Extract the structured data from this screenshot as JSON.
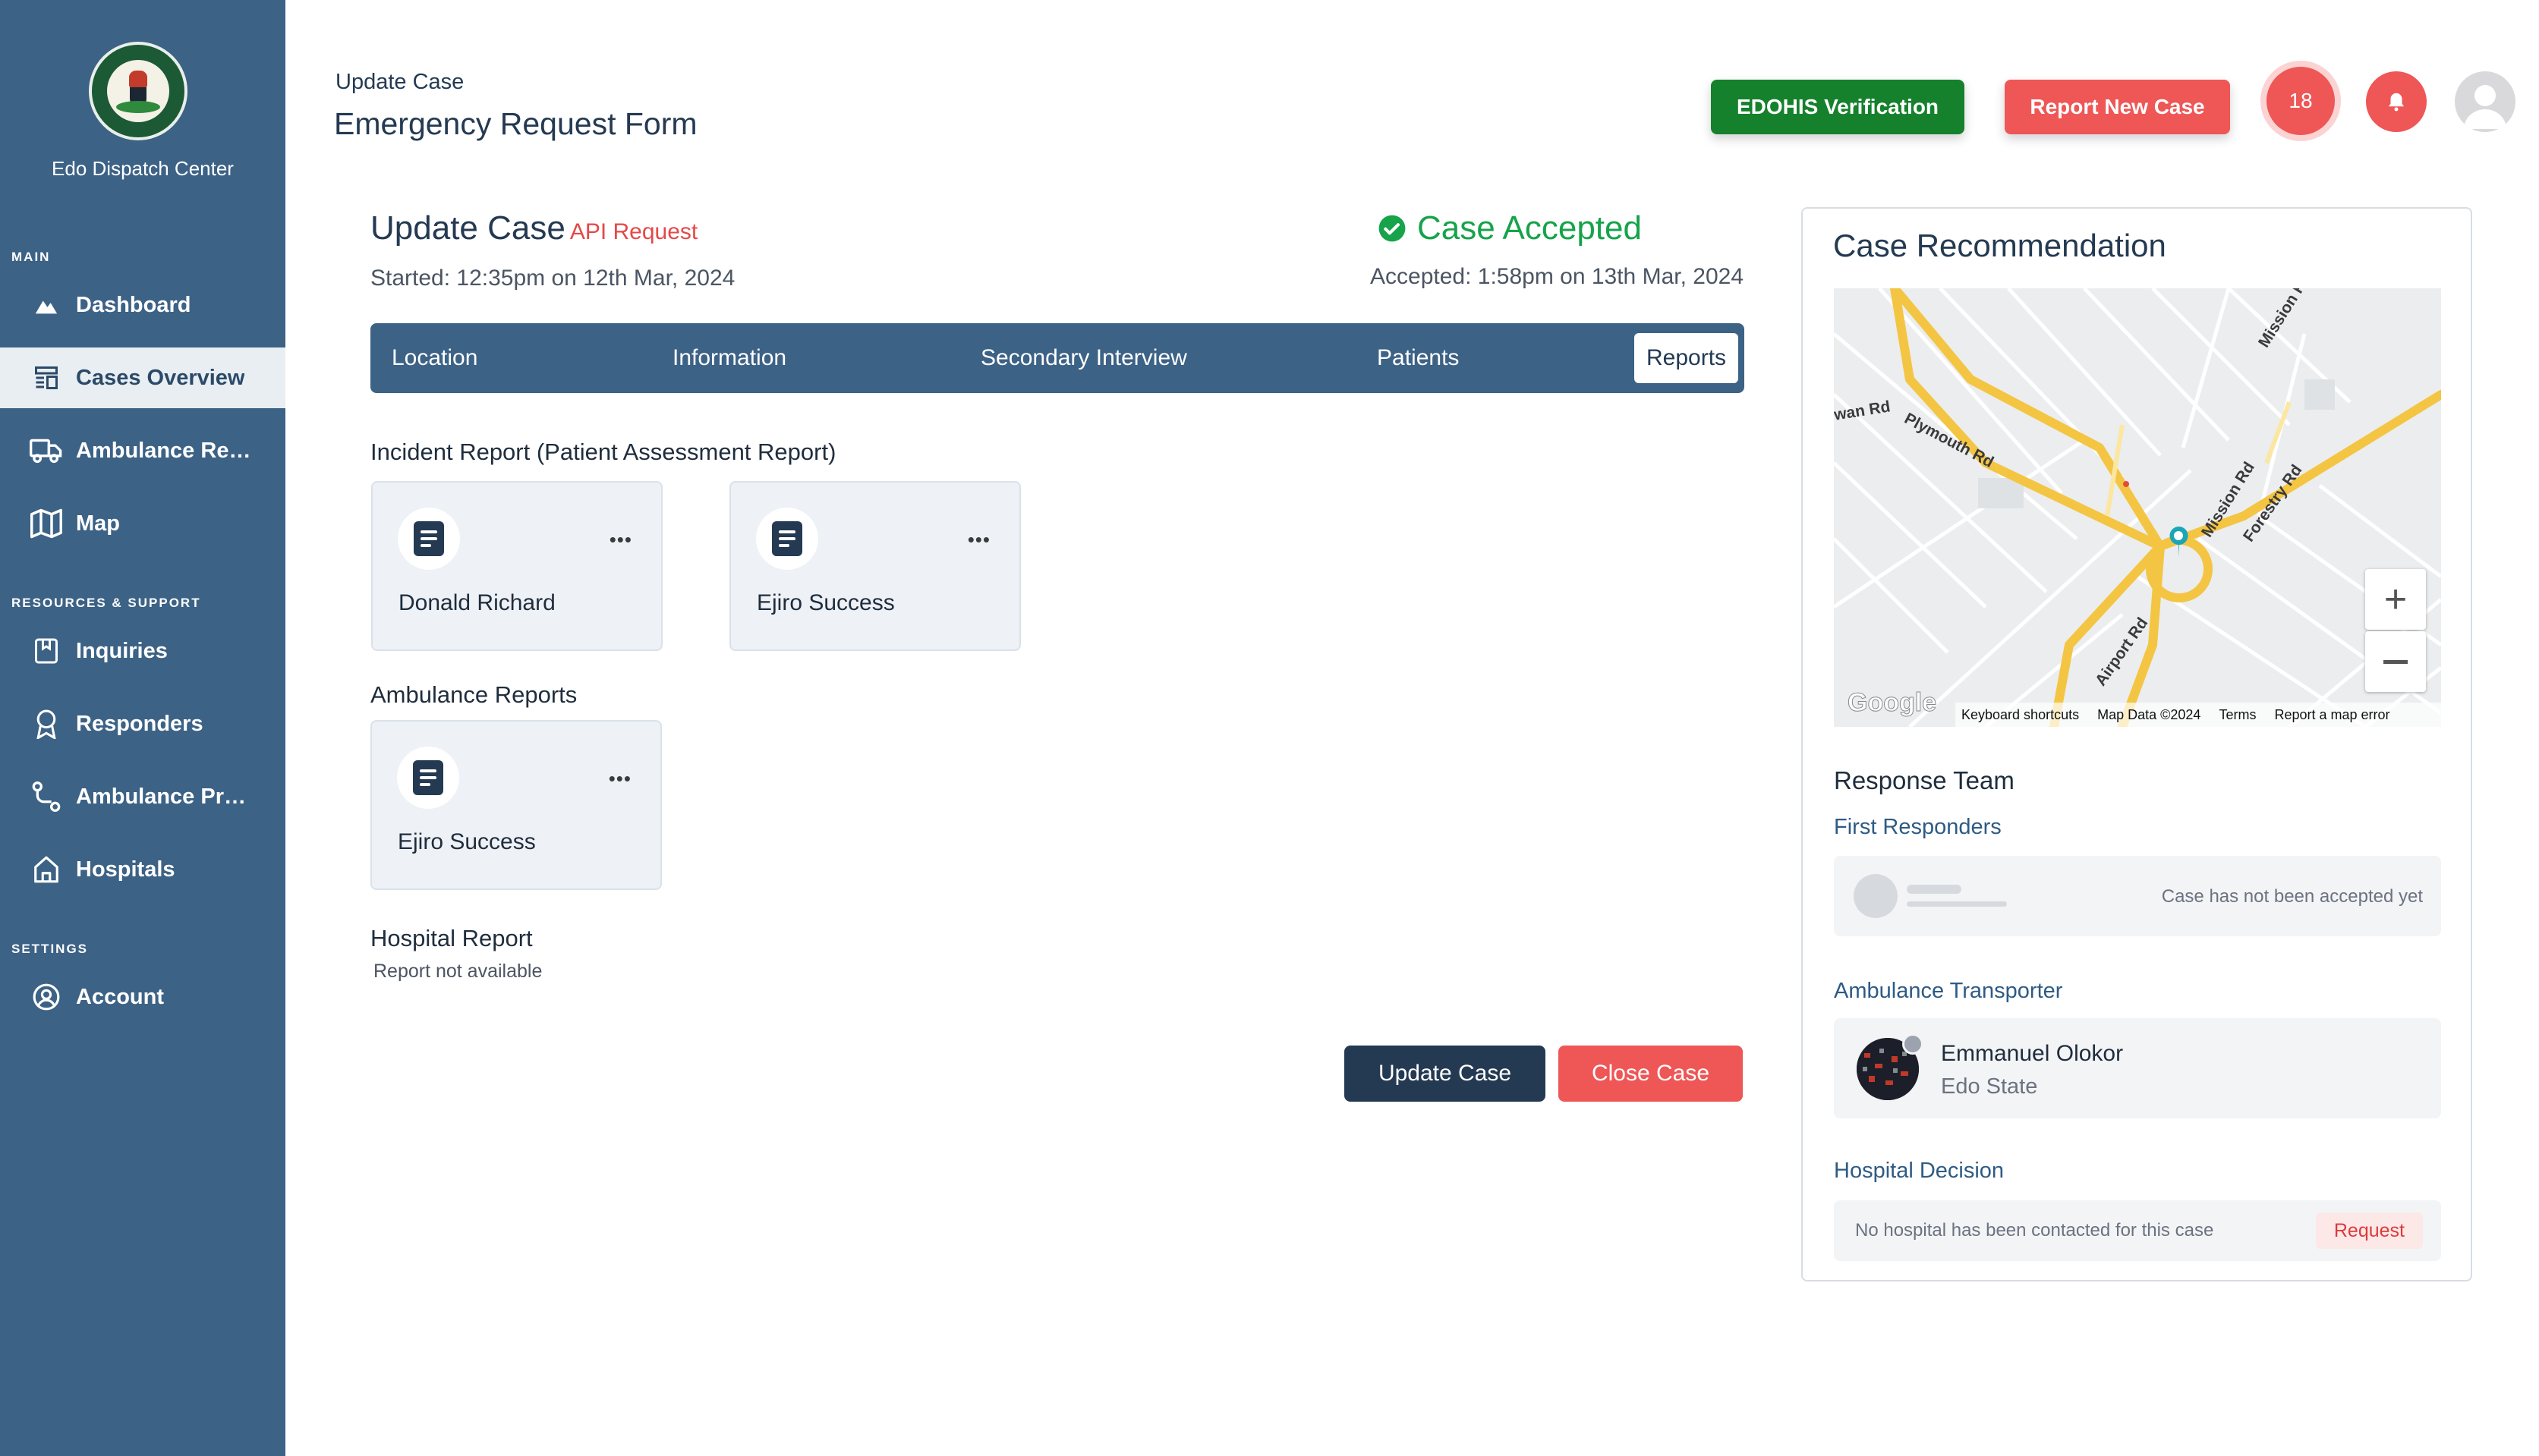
{
  "sidebar": {
    "brand": "Edo Dispatch Center",
    "sections": {
      "main": "MAIN",
      "resources": "RESOURCES & SUPPORT",
      "settings": "SETTINGS"
    },
    "items": [
      {
        "label": "Dashboard",
        "icon": "dashboard-icon"
      },
      {
        "label": "Cases Overview",
        "icon": "cases-icon",
        "active": true
      },
      {
        "label": "Ambulance Req...",
        "icon": "ambulance-icon"
      },
      {
        "label": "Map",
        "icon": "map-icon"
      },
      {
        "label": "Inquiries",
        "icon": "inquiries-icon"
      },
      {
        "label": "Responders",
        "icon": "responders-icon"
      },
      {
        "label": "Ambulance Prov...",
        "icon": "route-icon"
      },
      {
        "label": "Hospitals",
        "icon": "hospital-icon"
      },
      {
        "label": "Account",
        "icon": "account-icon"
      }
    ]
  },
  "header": {
    "subtitle": "Update Case",
    "title": "Emergency Request Form",
    "verify_label": "EDOHIS Verification",
    "report_label": "Report New Case",
    "notification_count": "18"
  },
  "case": {
    "title": "Update Case",
    "tag": "API Request",
    "started": "Started: 12:35pm on 12th Mar, 2024",
    "status": "Case Accepted",
    "accepted": "Accepted: 1:58pm on 13th Mar, 2024"
  },
  "tabs": [
    {
      "label": "Location"
    },
    {
      "label": "Information"
    },
    {
      "label": "Secondary Interview"
    },
    {
      "label": "Patients"
    },
    {
      "label": "Reports",
      "active": true
    }
  ],
  "reports": {
    "incident_title": "Incident Report (Patient Assessment Report)",
    "incident_cards": [
      "Donald Richard",
      "Ejiro Success"
    ],
    "ambulance_title": "Ambulance Reports",
    "ambulance_cards": [
      "Ejiro Success"
    ],
    "hospital_title": "Hospital Report",
    "hospital_note": "Report not available",
    "more_label": "•••"
  },
  "actions": {
    "update": "Update Case",
    "close": "Close Case"
  },
  "recommendation": {
    "title": "Case Recommendation",
    "map": {
      "roads": [
        "Mission Rd",
        "Plymouth Rd",
        "Mission Rd",
        "Forestry Rd",
        "Airport Rd"
      ],
      "partial_road": "wan Rd",
      "logo": "Google",
      "footer": [
        "Keyboard shortcuts",
        "Map Data ©2024",
        "Terms",
        "Report a map error"
      ]
    },
    "response_team": "Response Team",
    "first_responders": "First Responders",
    "first_responders_note": "Case has not been accepted yet",
    "ambulance_transporter": "Ambulance Transporter",
    "transporter": {
      "name": "Emmanuel Olokor",
      "state": "Edo State"
    },
    "hospital_decision": "Hospital Decision",
    "hospital_note": "No hospital has been contacted for this case",
    "request_label": "Request"
  },
  "colors": {
    "sidebar": "#3c6286",
    "navy": "#243a52",
    "accent_red": "#ef5656",
    "accent_green": "#15812c",
    "success": "#16a34a"
  }
}
